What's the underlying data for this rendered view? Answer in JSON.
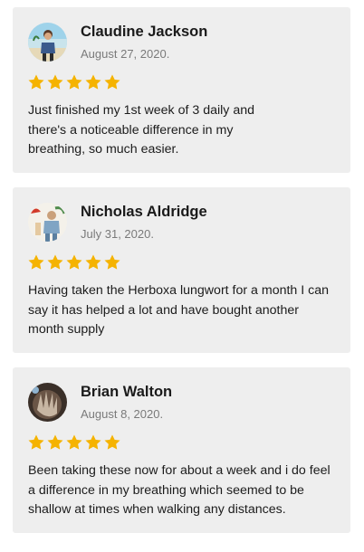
{
  "reviews": [
    {
      "name": "Claudine Jackson",
      "date": "August 27, 2020.",
      "rating": 5,
      "text": "Just finished my 1st week of 3 daily and there's a noticeable difference in my breathing, so much easier."
    },
    {
      "name": "Nicholas Aldridge",
      "date": "July 31, 2020.",
      "rating": 5,
      "text": "Having taken the Herboxa lungwort for a month I can say it has helped a lot and have bought another month supply"
    },
    {
      "name": "Brian Walton",
      "date": "August 8, 2020.",
      "rating": 5,
      "text": "Been taking these now for about a week and i do feel a difference in my breathing which seemed to be shallow at times when walking any distances."
    }
  ],
  "colors": {
    "card_background": "#eeeeee",
    "star": "#f5b301",
    "name": "#1a1a1a",
    "date": "#7a7a7a"
  },
  "icons": {
    "rating": "star-icon"
  }
}
